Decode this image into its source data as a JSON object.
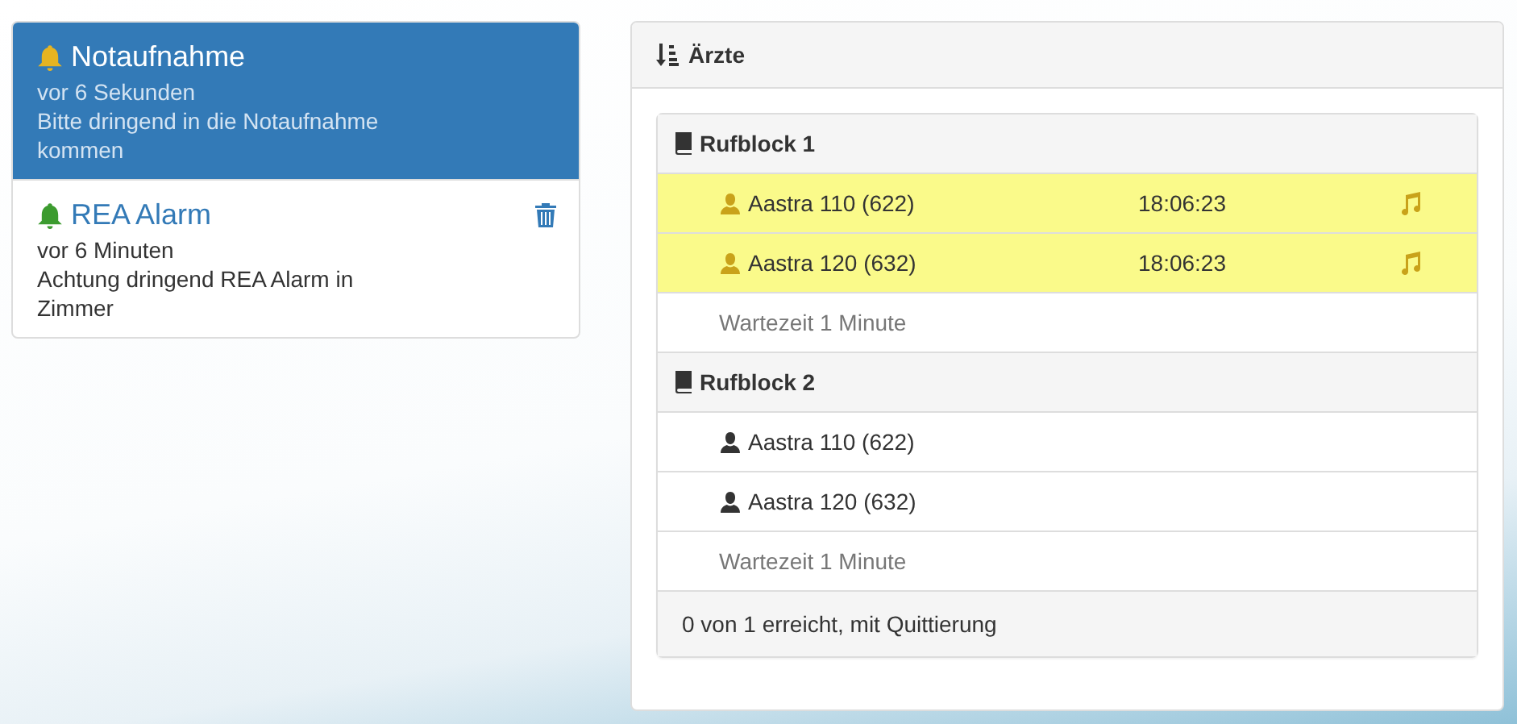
{
  "alerts": [
    {
      "title": "Notaufnahme",
      "time": "vor 6 Sekunden",
      "message": "Bitte dringend in die Notaufnahme kommen",
      "selected": true,
      "color": "#e6b422"
    },
    {
      "title": "REA Alarm",
      "time": "vor 6 Minuten",
      "message": "Achtung dringend REA Alarm in Zimmer",
      "selected": false,
      "color": "#3c9b2f"
    }
  ],
  "panel": {
    "title": "Ärzte",
    "blocks": [
      {
        "title": "Rufblock 1",
        "rows": [
          {
            "kind": "member",
            "name": "Aastra 110 (622)",
            "ringing": true,
            "time": "18:06:23"
          },
          {
            "kind": "member",
            "name": "Aastra 120 (632)",
            "ringing": true,
            "time": "18:06:23"
          },
          {
            "kind": "wait",
            "text": "Wartezeit 1 Minute"
          }
        ]
      },
      {
        "title": "Rufblock 2",
        "rows": [
          {
            "kind": "member",
            "name": "Aastra 110 (622)",
            "ringing": false
          },
          {
            "kind": "member",
            "name": "Aastra 120 (632)",
            "ringing": false
          },
          {
            "kind": "wait",
            "text": "Wartezeit 1 Minute"
          }
        ]
      }
    ],
    "footer": "0 von 1 erreicht, mit Quittierung"
  }
}
